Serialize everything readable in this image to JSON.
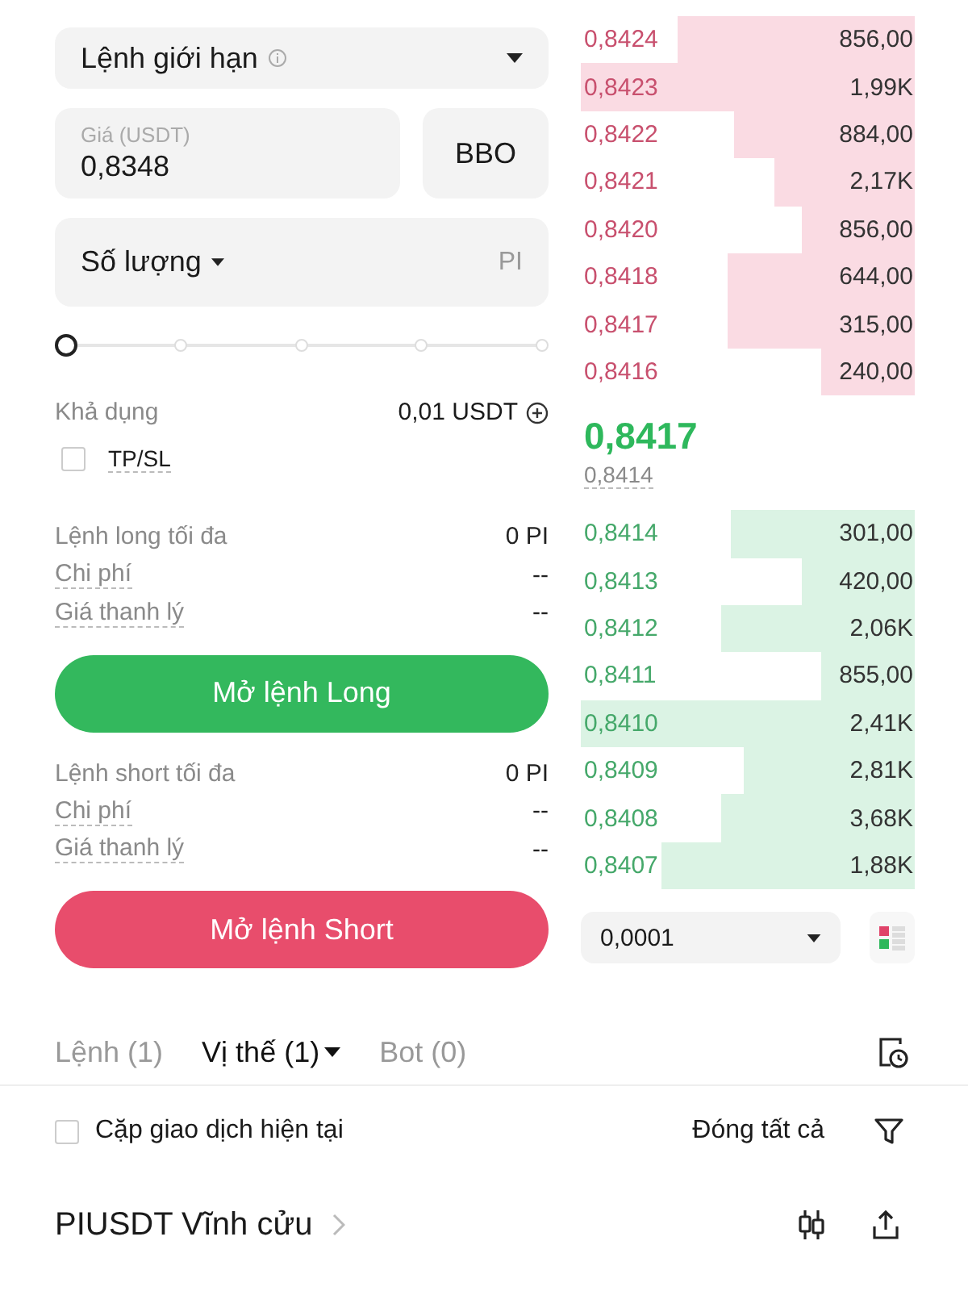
{
  "order_type": {
    "label": "Lệnh giới hạn",
    "info_icon": true
  },
  "price_field": {
    "label": "Giá (USDT)",
    "value": "0,8348"
  },
  "bbo_button": "BBO",
  "quantity_field": {
    "label": "Số lượng",
    "unit": "PI"
  },
  "slider": {
    "level": 0
  },
  "available": {
    "label": "Khả dụng",
    "value": "0,01 USDT"
  },
  "tpsl": {
    "label": "TP/SL",
    "checked": false
  },
  "long_info": [
    {
      "label": "Lệnh long tối đa",
      "value": "0 PI"
    },
    {
      "label": "Chi phí",
      "value": "--"
    },
    {
      "label": "Giá thanh lý",
      "value": "--"
    }
  ],
  "long_button": "Mở lệnh Long",
  "short_info": [
    {
      "label": "Lệnh short tối đa",
      "value": "0 PI"
    },
    {
      "label": "Chi phí",
      "value": "--"
    },
    {
      "label": "Giá thanh lý",
      "value": "--"
    }
  ],
  "short_button": "Mở lệnh Short",
  "asks": [
    {
      "price": "0,8424",
      "amount": "856,00"
    },
    {
      "price": "0,8423",
      "amount": "1,99K"
    },
    {
      "price": "0,8422",
      "amount": "884,00"
    },
    {
      "price": "0,8421",
      "amount": "2,17K"
    },
    {
      "price": "0,8420",
      "amount": "856,00"
    },
    {
      "price": "0,8418",
      "amount": "644,00"
    },
    {
      "price": "0,8417",
      "amount": "315,00"
    },
    {
      "price": "0,8416",
      "amount": "240,00"
    }
  ],
  "last_price": "0,8417",
  "mark_price": "0,8414",
  "bids": [
    {
      "price": "0,8414",
      "amount": "301,00"
    },
    {
      "price": "0,8413",
      "amount": "420,00"
    },
    {
      "price": "0,8412",
      "amount": "2,06K"
    },
    {
      "price": "0,8411",
      "amount": "855,00"
    },
    {
      "price": "0,8410",
      "amount": "2,41K"
    },
    {
      "price": "0,8409",
      "amount": "2,81K"
    },
    {
      "price": "0,8408",
      "amount": "3,68K"
    },
    {
      "price": "0,8407",
      "amount": "1,88K"
    }
  ],
  "tick_size": "0,0001",
  "tabs": [
    {
      "label": "Lệnh (1)",
      "selected": false,
      "dropdown": false
    },
    {
      "label": "Vị thế (1)",
      "selected": true,
      "dropdown": true
    },
    {
      "label": "Bot (0)",
      "selected": false,
      "dropdown": false
    }
  ],
  "current_pair": {
    "label": "Cặp giao dịch hiện tại",
    "checked": false
  },
  "close_all": "Đóng tất cả",
  "position": {
    "symbol": "PIUSDT Vĩnh cửu"
  }
}
